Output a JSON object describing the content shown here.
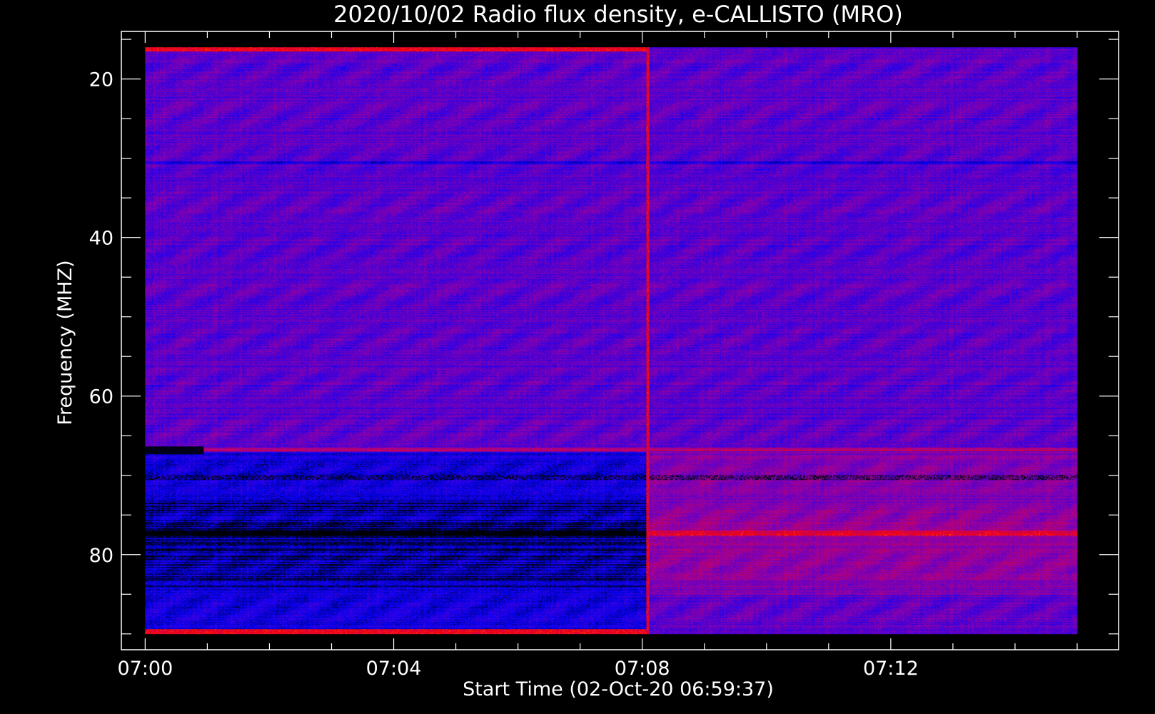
{
  "chart_data": {
    "type": "heatmap",
    "title": "2020/10/02  Radio flux density, e-CALLISTO (MRO)",
    "xlabel": "Start Time (02-Oct-20 06:59:37)",
    "ylabel": "Frequency (MHZ)",
    "x_tick_labels": [
      "07:00",
      "07:04",
      "07:08",
      "07:12"
    ],
    "y_tick_labels": [
      "20",
      "40",
      "60",
      "80"
    ],
    "x_range": [
      "06:59:37",
      "07:15:40"
    ],
    "y_range": [
      14,
      92
    ],
    "y_inverted": true,
    "data_time_range": [
      "07:00:00",
      "07:15:00"
    ],
    "data_freq_range_mhz": [
      16,
      90
    ],
    "instrument_change_time": "07:08:05",
    "colormap": [
      "#000000",
      "#0000ff",
      "#ff0000",
      "#ffff00"
    ],
    "frame_color": "#ffffff"
  }
}
